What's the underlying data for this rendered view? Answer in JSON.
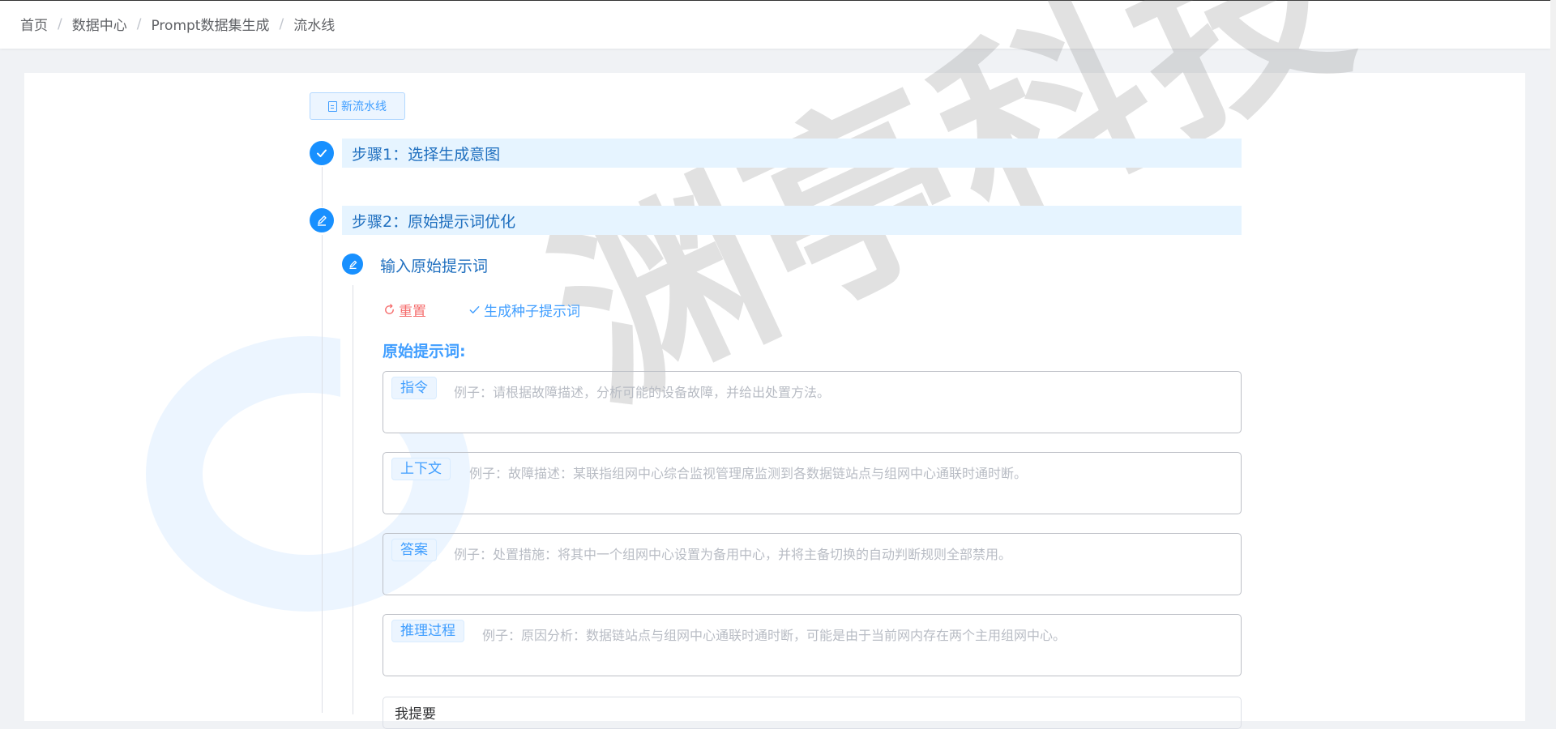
{
  "breadcrumb": [
    "首页",
    "数据中心",
    "Prompt数据集生成",
    "流水线"
  ],
  "breadcrumb_sep": "/",
  "new_pipeline_button": "新流水线",
  "steps": [
    {
      "label": "步骤1：选择生成意图",
      "status": "completed"
    },
    {
      "label": "步骤2：原始提示词优化",
      "status": "editing"
    }
  ],
  "substep": {
    "label": "输入原始提示词",
    "status": "editing"
  },
  "actions": {
    "reset": "重置",
    "generate": "生成种子提示词"
  },
  "section_title": "原始提示词:",
  "prompt_fields": [
    {
      "tag": "指令",
      "placeholder": "例子：请根据故障描述，分析可能的设备故障，并给出处置方法。"
    },
    {
      "tag": "上下文",
      "placeholder": "例子：故障描述：某联指组网中心综合监视管理席监测到各数据链站点与组网中心通联时通时断。"
    },
    {
      "tag": "答案",
      "placeholder": "例子：处置措施：将其中一个组网中心设置为备用中心，并将主备切换的自动判断规则全部禁用。"
    },
    {
      "tag": "推理过程",
      "placeholder": "例子：原因分析：数据链站点与组网中心通联时通时断，可能是由于当前网内存在两个主用组网中心。"
    }
  ],
  "next_box_label": "我提要",
  "watermark": "渊亭科技",
  "colors": {
    "primary": "#409eff",
    "step": "#1890ff",
    "danger": "#f56c6c",
    "step_bar": "#e6f4ff"
  }
}
